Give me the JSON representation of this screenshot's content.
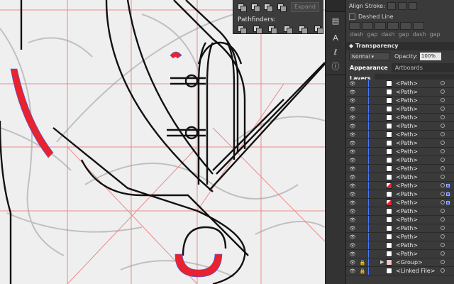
{
  "pathfinder": {
    "expand_label": "Expand",
    "pathfinders_label": "Pathfinders:"
  },
  "stroke": {
    "align_stroke_label": "Align Stroke:",
    "dashed_line_label": "Dashed Line",
    "dash_labels": [
      "dash",
      "gap",
      "dash",
      "gap",
      "dash",
      "gap"
    ]
  },
  "transparency": {
    "title": "Transparency",
    "blend_mode": "Normal",
    "opacity_label": "Opacity:",
    "opacity_value": "100%"
  },
  "tabs": [
    "Appearance",
    "Artboards"
  ],
  "layers": {
    "title": "Layers",
    "rows": [
      {
        "name": "<Path>",
        "thumb": "plain",
        "selected": false
      },
      {
        "name": "<Path>",
        "thumb": "plain",
        "selected": false
      },
      {
        "name": "<Path>",
        "thumb": "plain",
        "selected": false
      },
      {
        "name": "<Path>",
        "thumb": "plain",
        "selected": false
      },
      {
        "name": "<Path>",
        "thumb": "plain",
        "selected": false
      },
      {
        "name": "<Path>",
        "thumb": "plain",
        "selected": false
      },
      {
        "name": "<Path>",
        "thumb": "plain",
        "selected": false
      },
      {
        "name": "<Path>",
        "thumb": "plain",
        "selected": false
      },
      {
        "name": "<Path>",
        "thumb": "plain",
        "selected": false
      },
      {
        "name": "<Path>",
        "thumb": "plain",
        "selected": false
      },
      {
        "name": "<Path>",
        "thumb": "plain",
        "selected": false
      },
      {
        "name": "<Path>",
        "thumb": "plain",
        "selected": false
      },
      {
        "name": "<Path>",
        "thumb": "red",
        "selected": true
      },
      {
        "name": "<Path>",
        "thumb": "plain",
        "selected": true
      },
      {
        "name": "<Path>",
        "thumb": "red",
        "selected": true
      },
      {
        "name": "<Path>",
        "thumb": "plain",
        "selected": false
      },
      {
        "name": "<Path>",
        "thumb": "plain",
        "selected": false
      },
      {
        "name": "<Path>",
        "thumb": "plain",
        "selected": false
      },
      {
        "name": "<Path>",
        "thumb": "plain",
        "selected": false
      },
      {
        "name": "<Path>",
        "thumb": "plain",
        "selected": false
      },
      {
        "name": "<Path>",
        "thumb": "plain",
        "selected": false
      },
      {
        "name": "<Group>",
        "thumb": "group",
        "selected": false
      },
      {
        "name": "<Linked File>",
        "thumb": "plain",
        "selected": false
      }
    ]
  },
  "colors": {
    "accent_red": "#e8222e",
    "guide_red": "#e86a6a",
    "selection_blue": "#3366ff"
  }
}
